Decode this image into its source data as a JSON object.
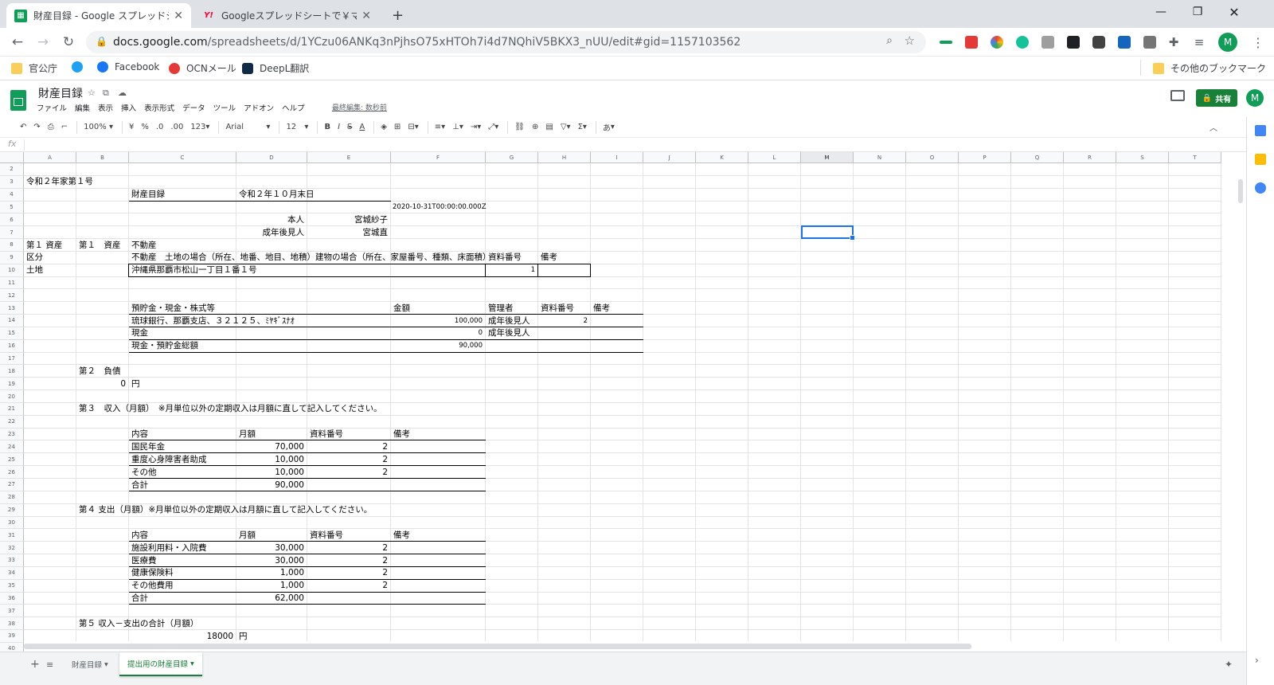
{
  "browser": {
    "tabs": [
      {
        "title": "財産目録 - Google スプレッドシート",
        "icon": "sheets-icon",
        "active": true
      },
      {
        "title": "Googleスプレッドシートで￥マークを消",
        "icon": "yahoo-icon",
        "active": false
      }
    ],
    "new_tab": "+",
    "url_host": "docs.google.com",
    "url_path": "/spreadsheets/d/1YCzu06ANKq3nPjhsO75xHTOh7i4d7NQhiV5BKX3_nUU/edit#gid=1157103562",
    "profile_initial": "M"
  },
  "bookmarks": [
    {
      "label": "官公庁",
      "icon": "folder-icon"
    },
    {
      "label": "",
      "icon": "twitter-icon"
    },
    {
      "label": "Facebook",
      "icon": "facebook-icon"
    },
    {
      "label": "OCNメール",
      "icon": "ocn-icon"
    },
    {
      "label": "DeepL翻訳",
      "icon": "deepl-icon"
    }
  ],
  "other_bookmarks": "その他のブックマーク",
  "doc": {
    "title": "財産目録",
    "menus": [
      "ファイル",
      "編集",
      "表示",
      "挿入",
      "表示形式",
      "データ",
      "ツール",
      "アドオン",
      "ヘルプ"
    ],
    "last_edit": "最終編集: 数秒前",
    "share_label": "共有",
    "user_initial": "M"
  },
  "toolbar": {
    "zoom": "100%",
    "currency": "¥",
    "percent": "%",
    "dec_less": ".0",
    "dec_more": ".00",
    "format_more": "123",
    "font": "Arial",
    "font_size": "12",
    "bold": "B",
    "italic": "I",
    "strike": "S",
    "text_color": "A",
    "sigma": "Σ",
    "input_tools": "あ"
  },
  "formula_bar": {
    "fx": "fx",
    "value": ""
  },
  "columns": [
    "A",
    "B",
    "C",
    "D",
    "E",
    "F",
    "G",
    "H",
    "I",
    "J",
    "K",
    "L",
    "M",
    "N",
    "O",
    "P",
    "Q",
    "R",
    "S",
    "T"
  ],
  "selected_column": "M",
  "rows": [
    "2",
    "3",
    "4",
    "5",
    "6",
    "7",
    "8",
    "9",
    "10",
    "11",
    "12",
    "13",
    "14",
    "15",
    "16",
    "17",
    "18",
    "19",
    "20",
    "21",
    "22",
    "23",
    "24",
    "25",
    "26",
    "27",
    "28",
    "29",
    "30",
    "31",
    "32",
    "33",
    "34",
    "35",
    "36",
    "37",
    "38",
    "39",
    "40"
  ],
  "cells": {
    "r3_A": "令和２年家第１号",
    "r4_C": "財産目録",
    "r4_D": "令和２年１０月末日",
    "r5_F": "2020-10-31T00:00:00.000Z",
    "r6_D": "本人",
    "r6_E": "宮城紗子",
    "r7_D": "成年後見人",
    "r7_E": "宮城直",
    "r8_A": "第１ 資産",
    "r8_B": "第１　資産",
    "r8_C": "不動産",
    "r9_A": "区分",
    "r9_C": "不動産　土地の場合（所在、地番、地目、地積）建物の場合（所在、家屋番号、種類、床面積）",
    "r9_G": "資料番号",
    "r9_H": "備考",
    "r10_A": "土地",
    "r10_C": "沖縄県那覇市松山一丁目１番１号",
    "r10_G": "1",
    "r13_C": "預貯金・現金・株式等",
    "r13_F": "金額",
    "r13_G": "管理者",
    "r13_H": "資料番号",
    "r13_I": "備考",
    "r14_C": "琉球銀行、那覇支店、３２１２５、ﾐﾔｷﾞｽﾅｵ",
    "r14_F": "100,000",
    "r14_G": "成年後見人",
    "r14_H": "2",
    "r15_C": "現金",
    "r15_F": "0",
    "r15_G": "成年後見人",
    "r16_C": "現金・預貯金総額",
    "r16_F": "90,000",
    "r18_B": "第２　負債",
    "r19_B": "0",
    "r19_C": "円",
    "r21_B": "第３　収入（月額）　※月単位以外の定期収入は月額に直して記入してください。",
    "r23_C": "内容",
    "r23_D": "月額",
    "r23_E": "資料番号",
    "r23_F": "備考",
    "r24_C": "国民年金",
    "r24_D": "70,000",
    "r24_E": "2",
    "r25_C": "重度心身障害者助成",
    "r25_D": "10,000",
    "r25_E": "2",
    "r26_C": "その他",
    "r26_D": "10,000",
    "r26_E": "2",
    "r27_C": "合計",
    "r27_D": "90,000",
    "r29_B": "第４ 支出（月額）※月単位以外の定期収入は月額に直して記入してください。",
    "r31_C": "内容",
    "r31_D": "月額",
    "r31_E": "資料番号",
    "r31_F": "備考",
    "r32_C": "施設利用料・入院費",
    "r32_D": "30,000",
    "r32_E": "2",
    "r33_C": "医療費",
    "r33_D": "30,000",
    "r33_E": "2",
    "r34_C": "健康保険料",
    "r34_D": "1,000",
    "r34_E": "2",
    "r35_C": "その他費用",
    "r35_D": "1,000",
    "r35_E": "2",
    "r36_C": "合計",
    "r36_D": "62,000",
    "r38_B": "第５ 収入－支出の合計（月額）",
    "r39_C": "18000",
    "r39_D": "円"
  },
  "sheet_tabs": [
    {
      "label": "財産目録",
      "active": false
    },
    {
      "label": "提出用の財産目録",
      "active": true
    }
  ],
  "colors": {
    "accent": "#188038",
    "selection": "#1a73e8"
  }
}
